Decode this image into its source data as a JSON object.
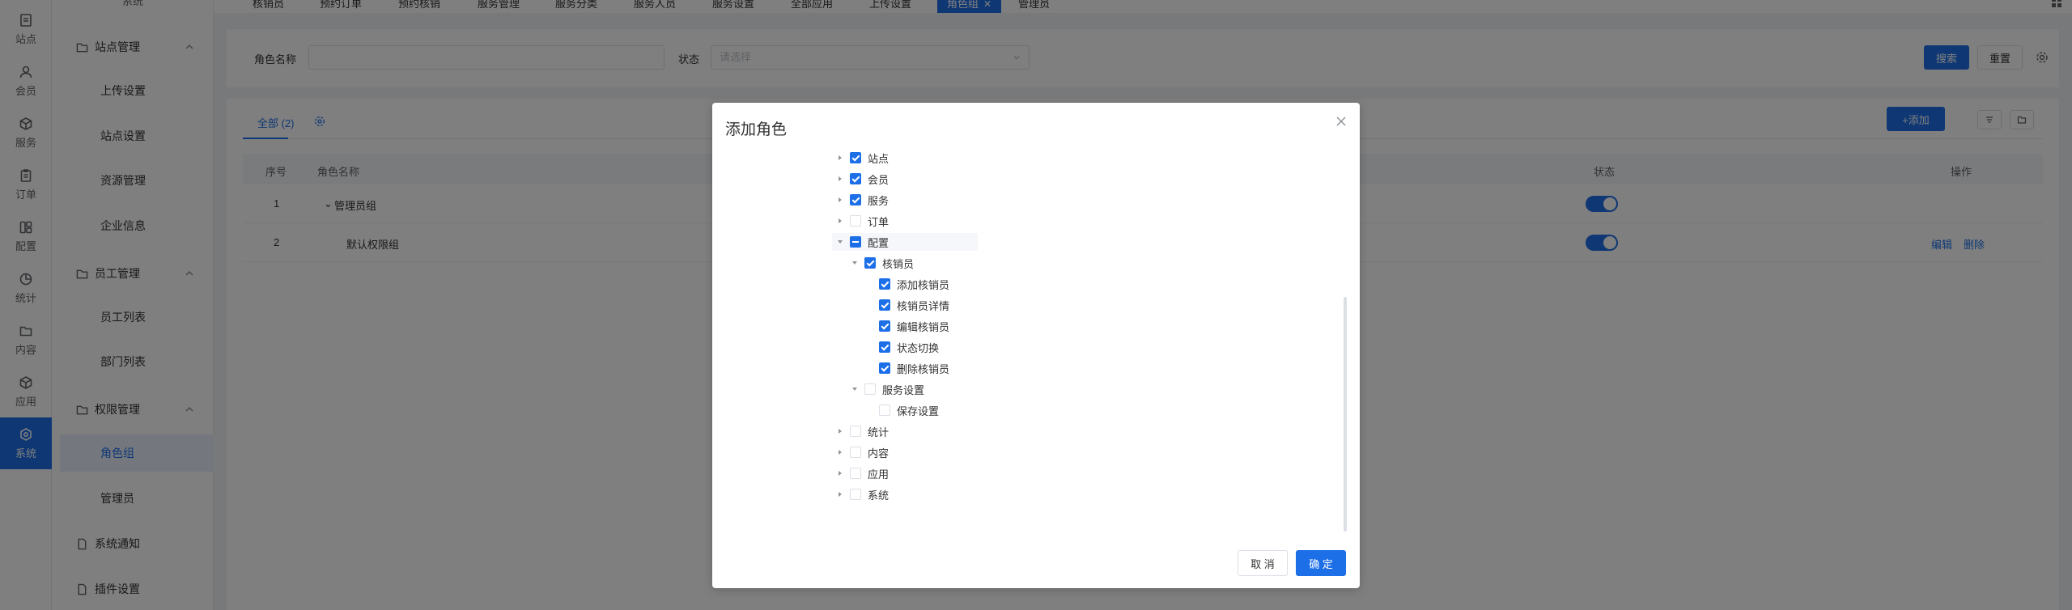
{
  "rail": [
    {
      "label": "站点",
      "icon": "dashboard-icon"
    },
    {
      "label": "会员",
      "icon": "user-icon"
    },
    {
      "label": "服务",
      "icon": "box-icon"
    },
    {
      "label": "订单",
      "icon": "clipboard-icon"
    },
    {
      "label": "配置",
      "icon": "layout-icon"
    },
    {
      "label": "统计",
      "icon": "pie-icon"
    },
    {
      "label": "内容",
      "icon": "folder-icon"
    },
    {
      "label": "应用",
      "icon": "cube-icon"
    },
    {
      "label": "系统",
      "icon": "settings-icon"
    }
  ],
  "sidebar": {
    "top_label": "系统",
    "groups": [
      {
        "label": "站点管理",
        "items": [
          "上传设置",
          "站点设置",
          "资源管理",
          "企业信息"
        ]
      },
      {
        "label": "员工管理",
        "items": [
          "员工列表",
          "部门列表"
        ]
      },
      {
        "label": "权限管理",
        "items": [
          "角色组",
          "管理员"
        ]
      }
    ],
    "extra": [
      "系统通知",
      "插件设置"
    ],
    "active_item": "角色组"
  },
  "tabs": [
    "核销员",
    "预约订单",
    "预约核销",
    "服务管理",
    "服务分类",
    "服务人员",
    "服务设置",
    "全部应用",
    "上传设置",
    "角色组",
    "管理员"
  ],
  "active_tab": "角色组",
  "search": {
    "name_label": "角色名称",
    "status_label": "状态",
    "status_placeholder": "请选择",
    "search_btn": "搜索",
    "reset_btn": "重置"
  },
  "panel": {
    "tab_label": "全部 (2)",
    "add_btn": "+添加",
    "columns": [
      "序号",
      "角色名称",
      "状态",
      "操作"
    ],
    "rows": [
      {
        "no": "1",
        "name": "管理员组",
        "enabled": true,
        "actions": []
      },
      {
        "no": "2",
        "name": "默认权限组",
        "enabled": true,
        "actions": [
          "编辑",
          "删除"
        ]
      }
    ]
  },
  "modal": {
    "title": "添加角色",
    "cancel": "取 消",
    "confirm": "确 定",
    "tree": [
      {
        "label": "站点",
        "level": 0,
        "state": "on",
        "expanded": false
      },
      {
        "label": "会员",
        "level": 0,
        "state": "on",
        "expanded": false
      },
      {
        "label": "服务",
        "level": 0,
        "state": "on",
        "expanded": false
      },
      {
        "label": "订单",
        "level": 0,
        "state": "off",
        "expanded": false
      },
      {
        "label": "配置",
        "level": 0,
        "state": "half",
        "expanded": true
      },
      {
        "label": "核销员",
        "level": 1,
        "state": "on",
        "expanded": true
      },
      {
        "label": "添加核销员",
        "level": 2,
        "state": "on",
        "leaf": true
      },
      {
        "label": "核销员详情",
        "level": 2,
        "state": "on",
        "leaf": true
      },
      {
        "label": "编辑核销员",
        "level": 2,
        "state": "on",
        "leaf": true
      },
      {
        "label": "状态切换",
        "level": 2,
        "state": "on",
        "leaf": true
      },
      {
        "label": "删除核销员",
        "level": 2,
        "state": "on",
        "leaf": true
      },
      {
        "label": "服务设置",
        "level": 1,
        "state": "off",
        "expanded": true
      },
      {
        "label": "保存设置",
        "level": 2,
        "state": "off",
        "leaf": true
      },
      {
        "label": "统计",
        "level": 0,
        "state": "off",
        "expanded": false
      },
      {
        "label": "内容",
        "level": 0,
        "state": "off",
        "expanded": false
      },
      {
        "label": "应用",
        "level": 0,
        "state": "off",
        "expanded": false
      },
      {
        "label": "系统",
        "level": 0,
        "state": "off",
        "expanded": false
      }
    ]
  },
  "colors": {
    "primary": "#1d6fe8",
    "mask": "rgba(0,0,0,0.5)"
  }
}
